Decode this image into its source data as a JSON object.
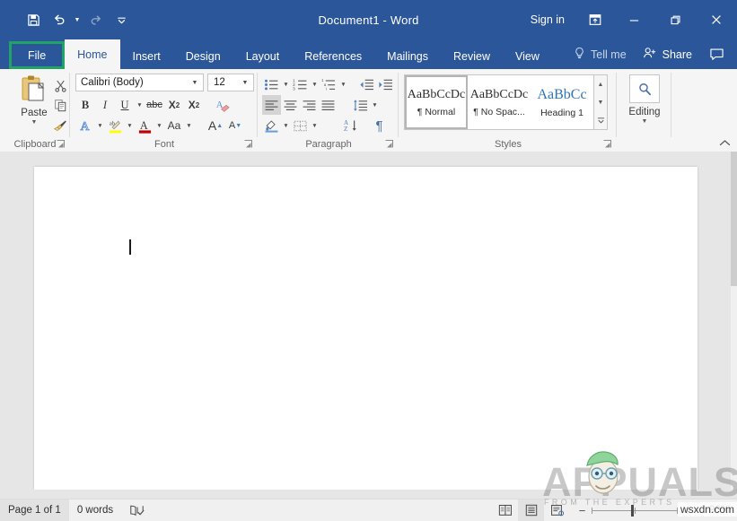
{
  "titlebar": {
    "document_title": "Document1  -  Word",
    "sign_in": "Sign in",
    "qat": [
      {
        "name": "save",
        "icon": "save-icon"
      },
      {
        "name": "undo",
        "icon": "undo-icon"
      },
      {
        "name": "redo",
        "icon": "redo-icon"
      },
      {
        "name": "customize-quick-access-toolbar",
        "icon": "chevron-down-icon"
      }
    ],
    "window_controls": {
      "ribbon_display_options": "ribbon-display-options-icon",
      "minimize": "minimize-icon",
      "restore": "restore-icon",
      "close": "close-icon"
    },
    "accent_color": "#2b579a"
  },
  "tabs": {
    "items": [
      {
        "label": "File",
        "key": "file",
        "state": "highlighted"
      },
      {
        "label": "Home",
        "key": "home",
        "state": "active"
      },
      {
        "label": "Insert",
        "key": "insert",
        "state": "normal"
      },
      {
        "label": "Design",
        "key": "design",
        "state": "normal"
      },
      {
        "label": "Layout",
        "key": "layout",
        "state": "normal"
      },
      {
        "label": "References",
        "key": "references",
        "state": "normal"
      },
      {
        "label": "Mailings",
        "key": "mailings",
        "state": "normal"
      },
      {
        "label": "Review",
        "key": "review",
        "state": "normal"
      },
      {
        "label": "View",
        "key": "view",
        "state": "normal"
      }
    ],
    "tell_me": "Tell me",
    "share": "Share",
    "file_highlight_color": "#21a366"
  },
  "ribbon": {
    "clipboard": {
      "label": "Clipboard",
      "paste_label": "Paste",
      "buttons": [
        "cut",
        "copy",
        "format-painter"
      ]
    },
    "font": {
      "label": "Font",
      "font_name": "Calibri (Body)",
      "font_size": "12",
      "row1": [
        "bold",
        "italic",
        "underline",
        "strikethrough",
        "subscript",
        "superscript"
      ],
      "row2": [
        "text-effects",
        "text-highlight-color",
        "font-color",
        "change-case"
      ],
      "grow_font": "A",
      "shrink_font": "A",
      "clear_formatting": "clear-formatting"
    },
    "paragraph": {
      "label": "Paragraph",
      "lists": [
        "bullets",
        "numbering",
        "multilevel-list"
      ],
      "indents": [
        "decrease-indent",
        "increase-indent"
      ],
      "alignment": [
        "align-left",
        "center",
        "align-right",
        "justify"
      ],
      "alignment_selected": "align-left",
      "other": [
        "line-spacing",
        "shading",
        "borders",
        "sort",
        "show-hide-marks"
      ]
    },
    "styles": {
      "label": "Styles",
      "items": [
        {
          "preview": "AaBbCcDc",
          "name": "¶ Normal",
          "selected": true
        },
        {
          "preview": "AaBbCcDc",
          "name": "¶ No Spac...",
          "selected": false
        },
        {
          "preview": "AaBbCc",
          "name": "Heading 1",
          "selected": false
        }
      ]
    },
    "editing": {
      "label": "Editing",
      "icon": "search-icon"
    },
    "collapse_ribbon": "collapse-ribbon"
  },
  "document": {
    "page_background": "#ffffff",
    "canvas_background": "#e6e6e6",
    "caret_visible": true
  },
  "status": {
    "page_indicator": "Page 1 of 1",
    "word_count": "0 words",
    "proofing_icon": "proofing-icon",
    "views": [
      {
        "name": "read-mode",
        "selected": false
      },
      {
        "name": "print-layout",
        "selected": true
      },
      {
        "name": "web-layout",
        "selected": false
      }
    ],
    "zoom_out": "−",
    "zoom_in": "+",
    "zoom_level": "90%"
  },
  "watermark": {
    "brand": "APPUALS",
    "tagline": "FROM THE EXPERTS",
    "site": "wsxdn.com"
  }
}
